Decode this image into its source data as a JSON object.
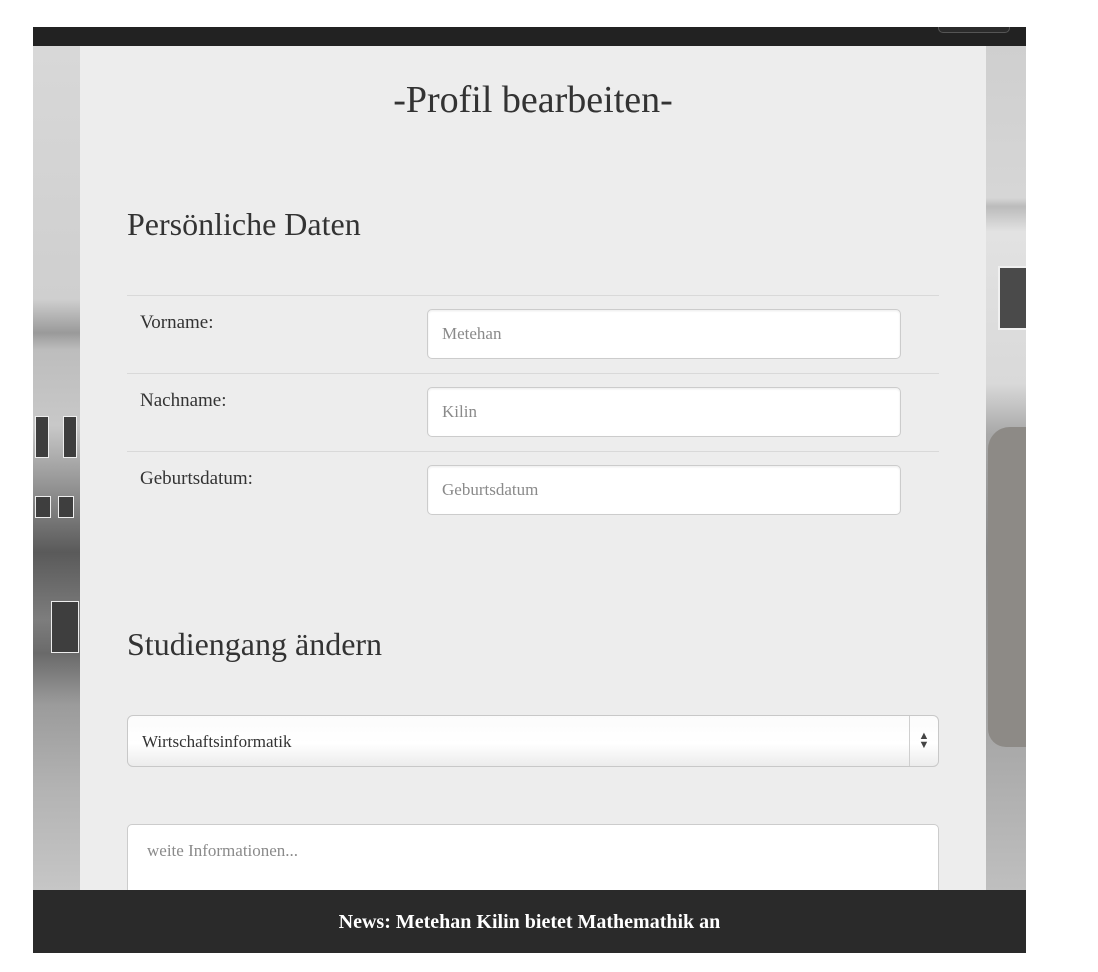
{
  "page": {
    "title": "-Profil bearbeiten-"
  },
  "personal": {
    "heading": "Persönliche Daten",
    "fields": [
      {
        "label": "Vorname:",
        "placeholder": "Metehan"
      },
      {
        "label": "Nachname:",
        "placeholder": "Kilin"
      },
      {
        "label": "Geburtsdatum:",
        "placeholder": "Geburtsdatum"
      }
    ]
  },
  "study": {
    "heading": "Studiengang ändern",
    "selected": "Wirtschaftsinformatik",
    "arrow_icon": "updown-arrows-icon"
  },
  "info": {
    "placeholder": "weite Informationen..."
  },
  "news": {
    "text": "News: Metehan Kilin bietet Mathemathik an"
  }
}
